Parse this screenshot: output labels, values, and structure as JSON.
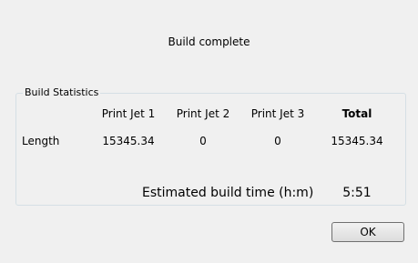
{
  "dialog": {
    "heading": "Build complete"
  },
  "stats": {
    "group_title": "Build Statistics",
    "columns": {
      "print_jet_1": "Print Jet 1",
      "print_jet_2": "Print Jet 2",
      "print_jet_3": "Print Jet 3",
      "total": "Total"
    },
    "length_row": {
      "label": "Length",
      "print_jet_1": "15345.34",
      "print_jet_2": "0",
      "print_jet_3": "0",
      "total": "15345.34"
    }
  },
  "estimate": {
    "label": "Estimated build time (h:m)",
    "value": "5:51"
  },
  "buttons": {
    "ok_label": "OK"
  }
}
